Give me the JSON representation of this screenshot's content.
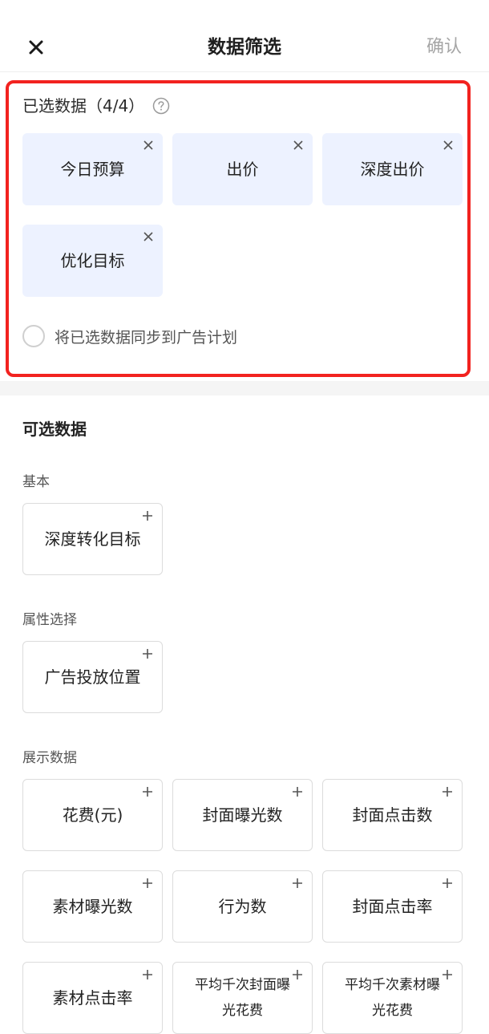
{
  "header": {
    "title": "数据筛选",
    "confirm_label": "确认"
  },
  "selected": {
    "title": "已选数据（4/4）",
    "items": [
      {
        "label": "今日预算"
      },
      {
        "label": "出价"
      },
      {
        "label": "深度出价"
      },
      {
        "label": "优化目标"
      }
    ],
    "sync_label": "将已选数据同步到广告计划"
  },
  "available": {
    "title": "可选数据",
    "groups": [
      {
        "label": "基本",
        "items": [
          {
            "label": "深度转化目标"
          }
        ]
      },
      {
        "label": "属性选择",
        "items": [
          {
            "label": "广告投放位置"
          }
        ]
      },
      {
        "label": "展示数据",
        "items": [
          {
            "label": "花费(元)"
          },
          {
            "label": "封面曝光数"
          },
          {
            "label": "封面点击数"
          },
          {
            "label": "素材曝光数"
          },
          {
            "label": "行为数"
          },
          {
            "label": "封面点击率"
          },
          {
            "label": "素材点击率"
          },
          {
            "label": "平均千次封面曝光花费"
          },
          {
            "label": "平均千次素材曝光花费"
          }
        ]
      }
    ]
  },
  "icons": {
    "close": "close-icon",
    "help": "question-circle-icon",
    "remove": "x-icon",
    "add": "plus-icon"
  },
  "colors": {
    "selected_bg": "#edf2ff",
    "highlight_border": "#f2221f",
    "confirm_text": "#a6a6a6"
  }
}
